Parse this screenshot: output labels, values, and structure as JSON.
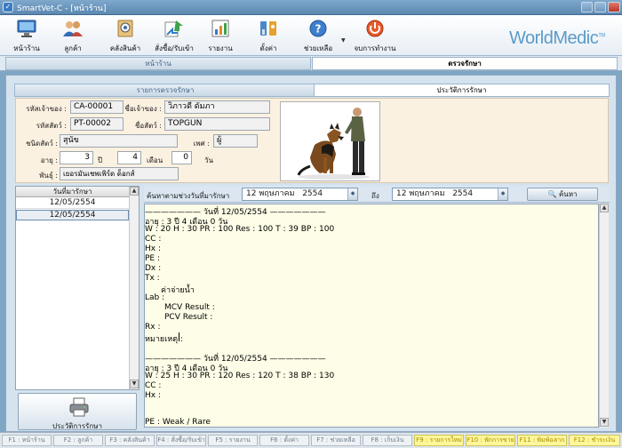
{
  "window": {
    "title": "SmartVet-C - [หน้าร้าน]"
  },
  "toolbar": {
    "items": [
      {
        "label": "หน้าร้าน",
        "icon": "monitor-icon"
      },
      {
        "label": "ลูกค้า",
        "icon": "people-icon"
      },
      {
        "label": "คลังสินค้า",
        "icon": "warehouse-icon"
      },
      {
        "label": "สั่งซื้อ/รับเข้า",
        "icon": "order-icon"
      },
      {
        "label": "รายงาน",
        "icon": "report-icon"
      },
      {
        "label": "ตั้งค่า",
        "icon": "settings-icon"
      },
      {
        "label": "ช่วยเหลือ",
        "icon": "help-icon"
      },
      {
        "label": "จบการทำงาน",
        "icon": "power-icon"
      }
    ],
    "brand": "WorldMedic",
    "brand_mark": "TM"
  },
  "top_tabs": [
    {
      "label": "หน้าร้าน"
    },
    {
      "label": "ตรวจรักษา"
    }
  ],
  "sub_tabs": [
    {
      "label": "รายการตรวจรักษา"
    },
    {
      "label": "ประวัติการรักษา"
    }
  ],
  "patient": {
    "owner_code_label": "รหัสเจ้าของ :",
    "owner_code": "CA-00001",
    "owner_name_label": "ชื่อเจ้าของ :",
    "owner_name": "วิภาวดี ดัมภา",
    "pet_code_label": "รหัสสัตว์ :",
    "pet_code": "PT-00002",
    "pet_name_label": "ชื่อสัตว์ :",
    "pet_name": "TOPGUN",
    "species_label": "ชนิดสัตว์ :",
    "species": "สุนัข",
    "sex_label": "เพศ :",
    "sex": "ผู้",
    "age_label": "อายุ :",
    "age_years": "3",
    "years_unit": "ปี",
    "age_months": "4",
    "months_unit": "เดือน",
    "age_days": "0",
    "days_unit": "วัน",
    "breed_label": "พันธุ์ :",
    "breed": "เยอรมันเชพเพิร์ด ด็อกส์"
  },
  "date_list": {
    "header": "วันที่มารักษา",
    "items": [
      {
        "date": "12/05/2554"
      },
      {
        "date": "12/05/2554"
      }
    ]
  },
  "history_button": {
    "label": "ประวัติการรักษา"
  },
  "search": {
    "label": "ค้นหาตามช่วงวันที่มารักษา",
    "from_day": "12",
    "from_month": "พฤษภาคม",
    "from_year": "2554",
    "to_label": "ถึง",
    "to_day": "12",
    "to_month": "พฤษภาคม",
    "to_year": "2554",
    "button_label": "ค้นหา"
  },
  "record": {
    "lines": [
      "——————— วันที่ 12/05/2554 ———————",
      "อายุ : 3 ปี 4 เดือน 0 วัน",
      "W : 20  H : 30  PR : 100  Res : 100  T : 39  BP : 100",
      "CC :",
      "Hx :",
      "PE :",
      "Dx :",
      "Tx :",
      "ค่าจ่ายน้ำ",
      "Lab :",
      "MCV  Result :",
      "PCV  Result :",
      "Rx :",
      "หมายเหตุ :",
      "",
      "——————— วันที่ 12/05/2554 ———————",
      "อายุ : 3 ปี 4 เดือน 0 วัน",
      "W : 25  H : 30  PR : 120  Res : 120  T : 38  BP : 130",
      "CC :",
      "Hx :",
      "",
      "",
      "PE : Weak / Rare"
    ]
  },
  "function_keys": [
    {
      "label": "F1 : หน้าร้าน",
      "highlight": false
    },
    {
      "label": "F2 : ลูกค้า",
      "highlight": false
    },
    {
      "label": "F3 : คลังสินค้า",
      "highlight": false
    },
    {
      "label": "F4 : สั่งซื้อ/รับเข้า",
      "highlight": false
    },
    {
      "label": "F5 : รายงาน",
      "highlight": false
    },
    {
      "label": "F6 : ตั้งค่า",
      "highlight": false
    },
    {
      "label": "F7 : ช่วยเหลือ",
      "highlight": false
    },
    {
      "label": "F8 : เก็บเงิน",
      "highlight": false
    },
    {
      "label": "F9 : รายการใหม่",
      "highlight": true
    },
    {
      "label": "F10 : พักการขาย",
      "highlight": true
    },
    {
      "label": "F11 : พิมพ์ฉลาก",
      "highlight": true
    },
    {
      "label": "F12 : ชำระเงิน",
      "highlight": true
    }
  ],
  "colors": {
    "brand": "#5b9bc8",
    "fkey_highlight": "#fff79a",
    "record_bg": "#fefde7",
    "info_bg": "#fbf1e1"
  }
}
